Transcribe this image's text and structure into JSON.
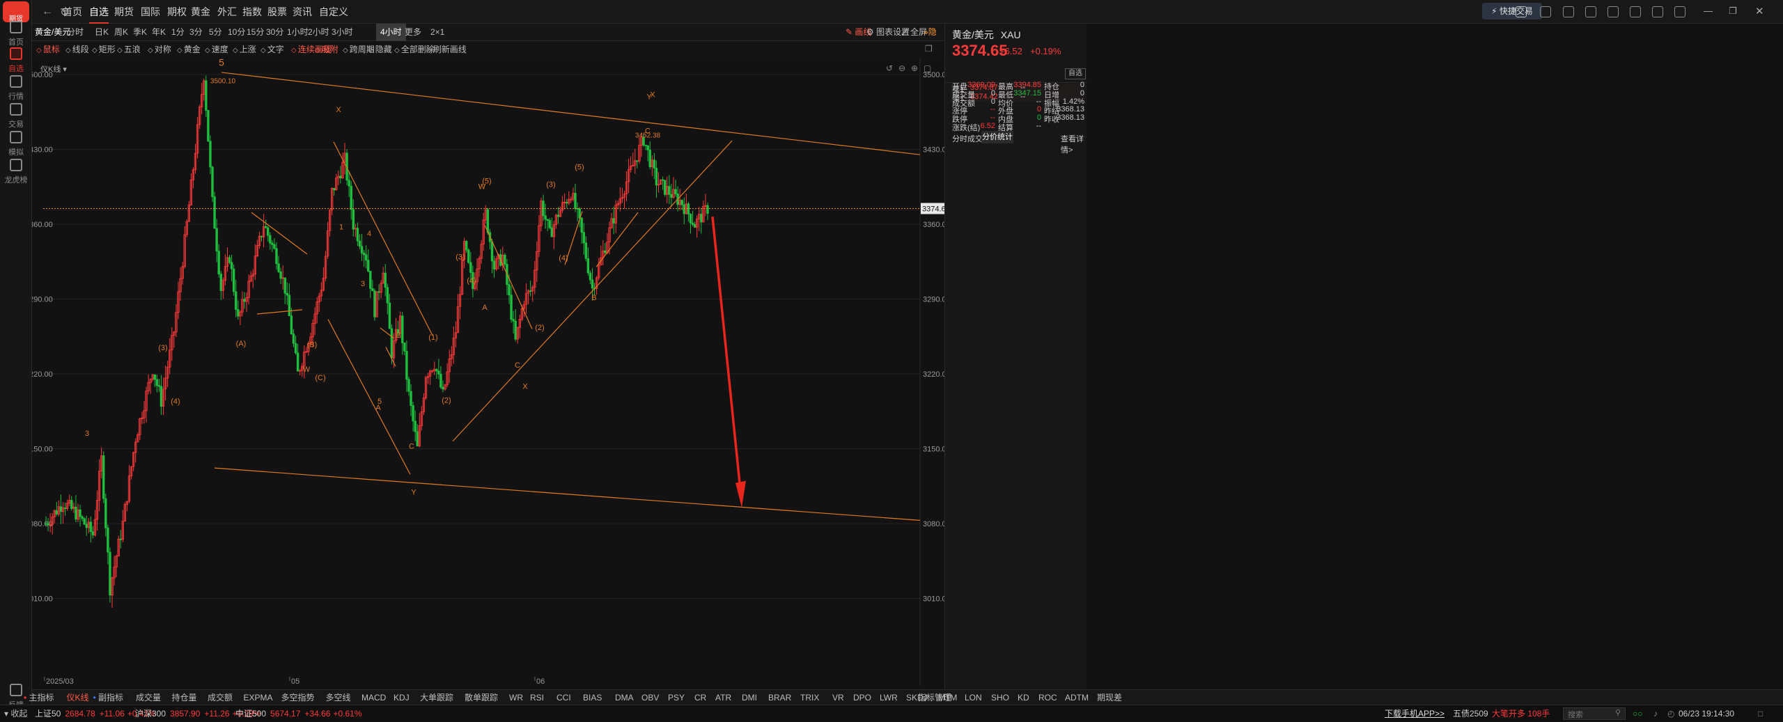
{
  "app": {
    "logo_text": "期货"
  },
  "leftbar": {
    "items": [
      {
        "label": "首页",
        "icon": "home-icon"
      },
      {
        "label": "自选",
        "icon": "star-icon",
        "active": true
      },
      {
        "label": "行情",
        "icon": "chart-icon"
      },
      {
        "label": "交易",
        "icon": "yen-icon"
      },
      {
        "label": "模拟",
        "icon": "gamepad-icon"
      },
      {
        "label": "龙虎榜",
        "icon": "database-icon"
      }
    ],
    "bottom": "反馈"
  },
  "topnav": {
    "items": [
      "首页",
      "自选",
      "期货",
      "国际",
      "期权",
      "黄金",
      "外汇",
      "指数",
      "股票",
      "资讯",
      "自定义"
    ],
    "active_index": 1,
    "quick_trade": "快捷交易"
  },
  "periods": {
    "symbol": "黄金/美元",
    "items": [
      "分时",
      "日K",
      "周K",
      "季K",
      "年K",
      "1分",
      "3分",
      "5分",
      "10分",
      "15分",
      "30分",
      "1小时",
      "2小时",
      "3小时",
      "4小时",
      "更多",
      "2×1"
    ],
    "active": "4小时",
    "draw_label": "画线",
    "chart_settings": "图表设置",
    "fullscreen": "全屏",
    "hide": "隐藏"
  },
  "drawtools": {
    "items": [
      "鼠标",
      "线段",
      "矩形",
      "五浪",
      "对称",
      "黄金",
      "速度",
      "上涨",
      "文字",
      "连续画线",
      "吸附",
      "跨周期",
      "隐藏",
      "全部删除",
      "刷新画线"
    ],
    "style_label": "仪K线"
  },
  "quote": {
    "name": "黄金/美元",
    "code": "XAU",
    "price": "3374.65",
    "change": "+6.52",
    "pct": "+0.19%",
    "watch_label": "自选",
    "sell_label": "卖1",
    "sell_price": "3374.87",
    "sell_vol": "--",
    "buy_label": "买1",
    "buy_price": "3374.42",
    "buy_vol": "--",
    "stats": [
      [
        "开盘",
        "3369.09",
        "最高",
        "3394.85",
        "持仓",
        "0"
      ],
      [
        "成交量",
        "0",
        "最低",
        "3347.15",
        "日增",
        "0"
      ],
      [
        "成交额",
        "0",
        "均价",
        "--",
        "振幅",
        "1.42%"
      ],
      [
        "涨停",
        "--",
        "外盘",
        "0",
        "昨结",
        "3368.13"
      ],
      [
        "跌停",
        "--",
        "内盘",
        "0",
        "昨收",
        "3368.13"
      ],
      [
        "涨跌(结)",
        "6.52",
        "结算",
        "--",
        "",
        ""
      ]
    ],
    "tabs": [
      "分时成交",
      "分价统计"
    ],
    "detail": "查看详情>"
  },
  "indicators": {
    "items": [
      "主指标",
      "仪K线",
      "副指标",
      "成交量",
      "持仓量",
      "成交额",
      "EXPMA",
      "多空指势",
      "多空线",
      "MACD",
      "KDJ",
      "大单跟踪",
      "散单跟踪",
      "WR",
      "RSI",
      "CCI",
      "BIAS",
      "DMA",
      "OBV",
      "PSY",
      "CR",
      "ATR",
      "DMI",
      "BRAR",
      "TRIX",
      "VR",
      "DPO",
      "LWR",
      "SKDJ",
      "MTM",
      "LON",
      "SHO",
      "KD",
      "ROC",
      "ADTM",
      "期现差"
    ],
    "manage": "指标管理"
  },
  "status": {
    "collapse": "收起",
    "items": [
      {
        "name": "上证50",
        "val": "2684.78",
        "chg": "+11.06",
        "pct": "+0.41%"
      },
      {
        "name": "沪深300",
        "val": "3857.90",
        "chg": "+11.26",
        "pct": "+0.29%"
      },
      {
        "name": "中证500",
        "val": "5674.17",
        "chg": "+34.66",
        "pct": "+0.61%"
      }
    ],
    "download": "下载手机APP>>",
    "contract": "五债2509",
    "contract_note": "大笔开多 108手",
    "search": "搜索",
    "datetime": "06/23 19:14:30"
  },
  "chart_data": {
    "type": "candlestick",
    "symbol": "XAU",
    "yticks": [
      3010,
      3080,
      3150,
      3220,
      3290,
      3360,
      3430,
      3500
    ],
    "yticklabels": [
      "3010.00",
      "3080.00",
      "3150.00",
      "3220.00",
      "3290.00",
      "3360.00",
      "3430.00",
      "3500.00"
    ],
    "xticks": [
      "2025/03",
      "05",
      "06"
    ],
    "last_price": "3374.65",
    "high_label": "3500.10",
    "recent_high_label": "3452.38",
    "swing_anchors": [
      [
        0,
        3080
      ],
      [
        8,
        3100
      ],
      [
        14,
        3090
      ],
      [
        22,
        3070
      ],
      [
        26,
        3140
      ],
      [
        30,
        3020
      ],
      [
        36,
        3080
      ],
      [
        42,
        3160
      ],
      [
        50,
        3225
      ],
      [
        54,
        3195
      ],
      [
        60,
        3260
      ],
      [
        66,
        3360
      ],
      [
        70,
        3430
      ],
      [
        74,
        3500
      ],
      [
        78,
        3380
      ],
      [
        82,
        3300
      ],
      [
        86,
        3330
      ],
      [
        90,
        3270
      ],
      [
        96,
        3310
      ],
      [
        102,
        3360
      ],
      [
        108,
        3330
      ],
      [
        112,
        3300
      ],
      [
        118,
        3220
      ],
      [
        124,
        3260
      ],
      [
        130,
        3310
      ],
      [
        134,
        3390
      ],
      [
        140,
        3420
      ],
      [
        144,
        3360
      ],
      [
        150,
        3330
      ],
      [
        154,
        3280
      ],
      [
        158,
        3320
      ],
      [
        162,
        3240
      ],
      [
        166,
        3270
      ],
      [
        170,
        3200
      ],
      [
        174,
        3150
      ],
      [
        178,
        3220
      ],
      [
        182,
        3230
      ],
      [
        186,
        3200
      ],
      [
        192,
        3260
      ],
      [
        196,
        3340
      ],
      [
        200,
        3300
      ],
      [
        206,
        3370
      ],
      [
        210,
        3320
      ],
      [
        214,
        3330
      ],
      [
        220,
        3250
      ],
      [
        224,
        3290
      ],
      [
        228,
        3300
      ],
      [
        232,
        3380
      ],
      [
        236,
        3350
      ],
      [
        240,
        3370
      ],
      [
        246,
        3390
      ],
      [
        250,
        3360
      ],
      [
        256,
        3300
      ],
      [
        262,
        3340
      ],
      [
        268,
        3380
      ],
      [
        274,
        3410
      ],
      [
        280,
        3440
      ],
      [
        286,
        3400
      ],
      [
        292,
        3390
      ],
      [
        298,
        3380
      ],
      [
        304,
        3360
      ],
      [
        310,
        3375
      ]
    ],
    "wave_labels": [
      "5",
      "3",
      "(3)",
      "(4)",
      "(A)",
      "(B)",
      "(C)",
      "W",
      "X",
      "1",
      "3",
      "4",
      "5",
      "A",
      "B",
      "C",
      "Y",
      "(1)",
      "(2)",
      "(3)",
      "(4)",
      "(5)",
      "W",
      "A",
      "C",
      "(2)",
      "X",
      "(3)",
      "(4)",
      "(5)",
      "B",
      "Y",
      "X",
      "C"
    ]
  }
}
